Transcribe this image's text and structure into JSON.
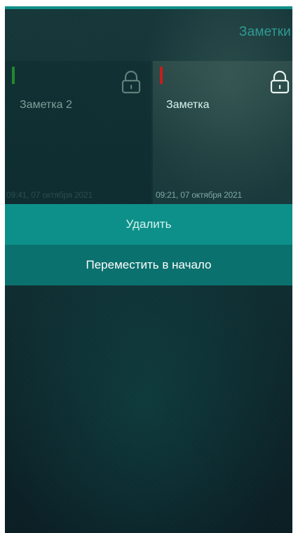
{
  "header": {
    "title": "Заметки"
  },
  "notes": [
    {
      "title": "Заметка 2",
      "date": "09:41, 07 октября 2021",
      "marker_color": "#1f8a2e",
      "icon": "lock-icon"
    },
    {
      "title": "Заметка",
      "date": "09:21, 07 октября 2021",
      "marker_color": "#c91c1c",
      "icon": "lock-icon"
    }
  ],
  "context_menu": {
    "delete_label": "Удалить",
    "move_to_start_label": "Переместить в начало"
  },
  "colors": {
    "accent": "#0e908a",
    "accent_dark": "#0b716e",
    "background": "#0f2b2f"
  }
}
